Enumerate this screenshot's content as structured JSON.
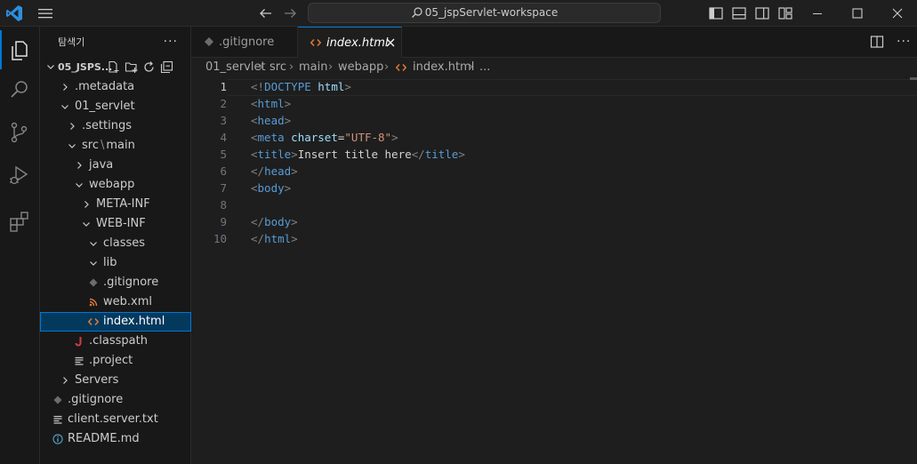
{
  "window": {
    "search_text": "05_jspServlet-workspace",
    "accent": "#0078d4"
  },
  "activity_bar": {
    "items": [
      "explorer-icon",
      "search-icon",
      "source-control-icon",
      "run-debug-icon",
      "extensions-icon"
    ]
  },
  "sidebar": {
    "title": "탐색기",
    "more": "···",
    "root_label": "05_JSPS...",
    "tree": [
      {
        "label": ".metadata",
        "icon": "chevron-right"
      },
      {
        "label": "01_servlet",
        "icon": "chevron-down"
      },
      {
        "label": ".settings",
        "icon": "chevron-right"
      },
      {
        "label": "src",
        "sep": "\\",
        "label2": "main",
        "icon": "chevron-down"
      },
      {
        "label": "java",
        "icon": "chevron-right"
      },
      {
        "label": "webapp",
        "icon": "chevron-down"
      },
      {
        "label": "META-INF",
        "icon": "chevron-right"
      },
      {
        "label": "WEB-INF",
        "icon": "chevron-down"
      },
      {
        "label": "classes",
        "icon": "chevron-down"
      },
      {
        "label": "lib",
        "icon": "chevron-down"
      },
      {
        "label": ".gitignore",
        "icon": "git-file"
      },
      {
        "label": "web.xml",
        "icon": "rss-file"
      },
      {
        "label": "index.html",
        "icon": "html-file"
      },
      {
        "label": ".classpath",
        "icon": "java-file"
      },
      {
        "label": ".project",
        "icon": "lines-file"
      },
      {
        "label": "Servers",
        "icon": "chevron-right"
      },
      {
        "label": ".gitignore",
        "icon": "git-file"
      },
      {
        "label": "client.server.txt",
        "icon": "lines-file"
      },
      {
        "label": "README.md",
        "icon": "info-file"
      }
    ]
  },
  "tabs": [
    {
      "label": ".gitignore"
    },
    {
      "label": "index.html",
      "close": "✕"
    }
  ],
  "tab_more": "···",
  "breadcrumb": [
    "01_servlet",
    "src",
    "main",
    "webapp",
    "index.html",
    "..."
  ],
  "editor": {
    "line_numbers": [
      "1",
      "2",
      "3",
      "4",
      "5",
      "6",
      "7",
      "8",
      "9",
      "10"
    ],
    "lines": [
      [
        {
          "t": "<!",
          "c": "br"
        },
        {
          "t": "DOCTYPE",
          "c": "tag"
        },
        {
          "t": " ",
          "c": "txt"
        },
        {
          "t": "html",
          "c": "attr"
        },
        {
          "t": ">",
          "c": "br"
        }
      ],
      [
        {
          "t": "<",
          "c": "br"
        },
        {
          "t": "html",
          "c": "tag"
        },
        {
          "t": ">",
          "c": "br"
        }
      ],
      [
        {
          "t": "<",
          "c": "br"
        },
        {
          "t": "head",
          "c": "tag"
        },
        {
          "t": ">",
          "c": "br"
        }
      ],
      [
        {
          "t": "<",
          "c": "br"
        },
        {
          "t": "meta",
          "c": "tag"
        },
        {
          "t": " ",
          "c": "txt"
        },
        {
          "t": "charset",
          "c": "attr"
        },
        {
          "t": "=",
          "c": "txt"
        },
        {
          "t": "\"UTF-8\"",
          "c": "str"
        },
        {
          "t": ">",
          "c": "br"
        }
      ],
      [
        {
          "t": "<",
          "c": "br"
        },
        {
          "t": "title",
          "c": "tag"
        },
        {
          "t": ">",
          "c": "br"
        },
        {
          "t": "Insert title here",
          "c": "txt"
        },
        {
          "t": "</",
          "c": "br"
        },
        {
          "t": "title",
          "c": "tag"
        },
        {
          "t": ">",
          "c": "br"
        }
      ],
      [
        {
          "t": "</",
          "c": "br"
        },
        {
          "t": "head",
          "c": "tag"
        },
        {
          "t": ">",
          "c": "br"
        }
      ],
      [
        {
          "t": "<",
          "c": "br"
        },
        {
          "t": "body",
          "c": "tag"
        },
        {
          "t": ">",
          "c": "br"
        }
      ],
      [],
      [
        {
          "t": "</",
          "c": "br"
        },
        {
          "t": "body",
          "c": "tag"
        },
        {
          "t": ">",
          "c": "br"
        }
      ],
      [
        {
          "t": "</",
          "c": "br"
        },
        {
          "t": "html",
          "c": "tag"
        },
        {
          "t": ">",
          "c": "br"
        }
      ]
    ]
  }
}
